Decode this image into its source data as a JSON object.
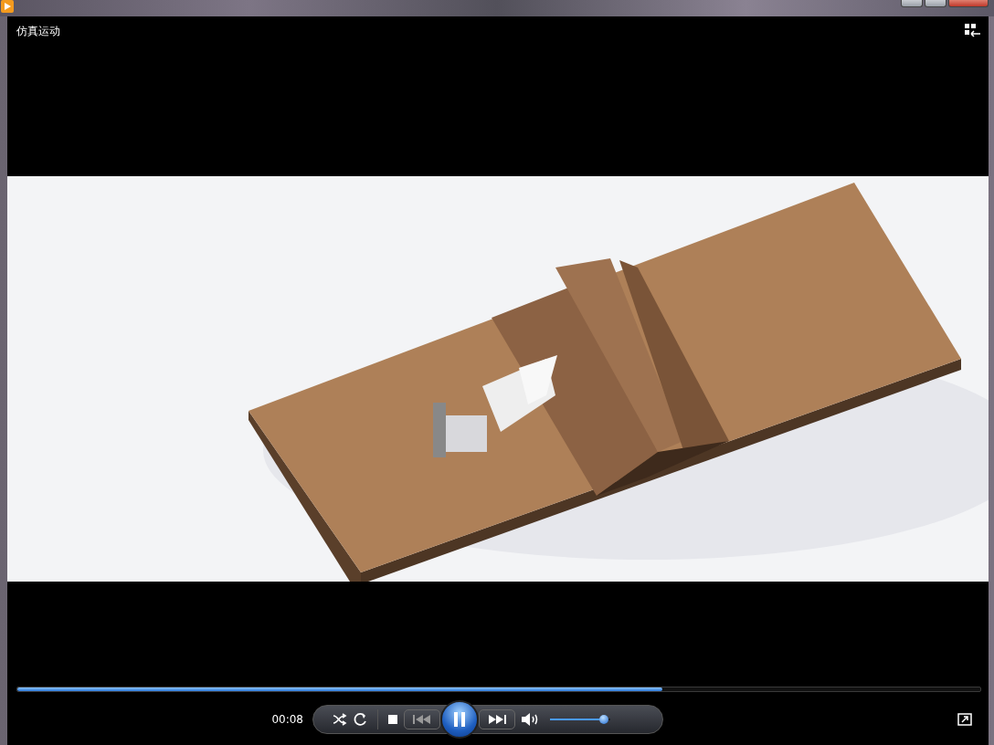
{
  "window": {
    "title": "仿真运动"
  },
  "seek": {
    "level": 0.67
  },
  "time": "00:08",
  "playback": {
    "playing": true
  },
  "volume": {
    "level": 0.9
  }
}
